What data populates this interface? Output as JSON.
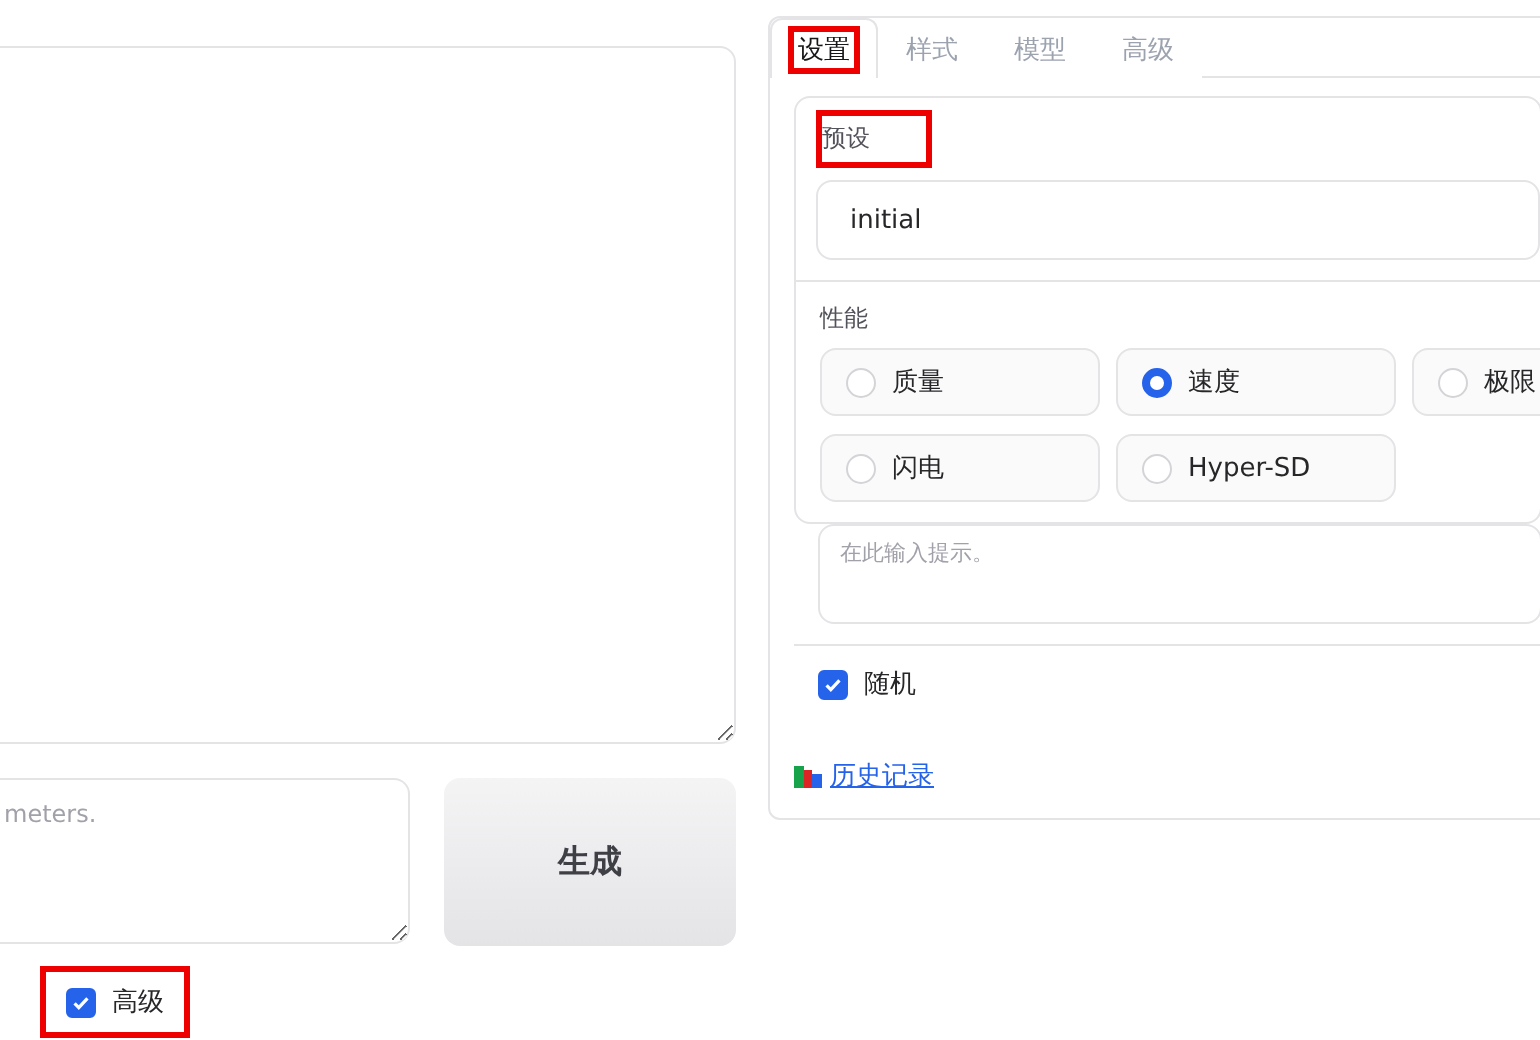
{
  "prompt": {
    "placeholder": "meters."
  },
  "generate_button": "生成",
  "advanced": {
    "label": "高级",
    "checked": true,
    "highlighted": true
  },
  "tabs": [
    {
      "label": "设置",
      "selected": true,
      "highlighted": true
    },
    {
      "label": "样式",
      "selected": false,
      "highlighted": false
    },
    {
      "label": "模型",
      "selected": false,
      "highlighted": false
    },
    {
      "label": "高级",
      "selected": false,
      "highlighted": false
    }
  ],
  "preset": {
    "label": "预设",
    "highlighted": true,
    "value": "initial"
  },
  "performance": {
    "label": "性能",
    "options": [
      {
        "label": "质量",
        "selected": false
      },
      {
        "label": "速度",
        "selected": true
      },
      {
        "label": "极限",
        "selected": false
      },
      {
        "label": "闪电",
        "selected": false
      },
      {
        "label": "Hyper-SD",
        "selected": false
      }
    ]
  },
  "negative_prompt": {
    "placeholder": "在此输入提示。"
  },
  "random": {
    "label": "随机",
    "checked": true
  },
  "history_link": "历史记录"
}
